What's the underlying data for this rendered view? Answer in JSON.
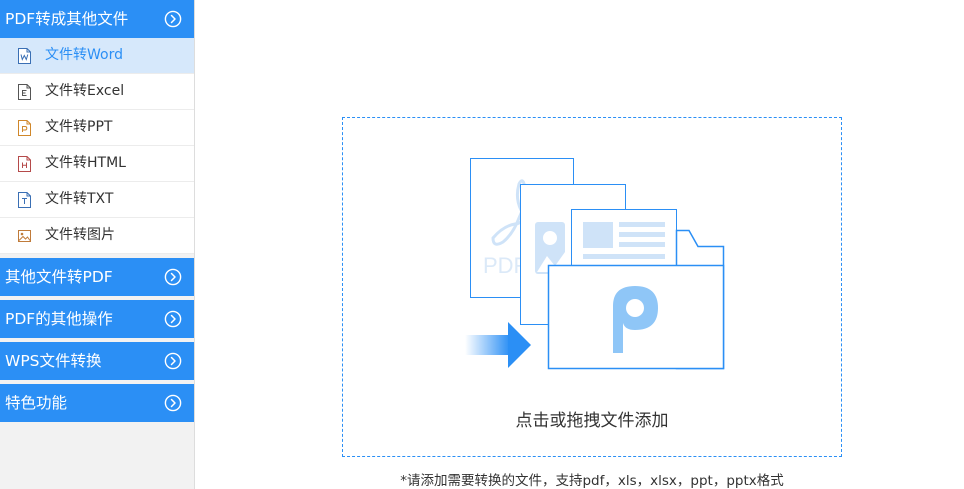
{
  "sidebar": {
    "groups": [
      {
        "label": "PDF转成其他文件",
        "expanded": true,
        "items": [
          {
            "label": "文件转Word",
            "icon": "word-file-icon",
            "active": true
          },
          {
            "label": "文件转Excel",
            "icon": "excel-file-icon",
            "active": false
          },
          {
            "label": "文件转PPT",
            "icon": "ppt-file-icon",
            "active": false
          },
          {
            "label": "文件转HTML",
            "icon": "html-file-icon",
            "active": false
          },
          {
            "label": "文件转TXT",
            "icon": "txt-file-icon",
            "active": false
          },
          {
            "label": "文件转图片",
            "icon": "image-file-icon",
            "active": false
          }
        ]
      },
      {
        "label": "其他文件转PDF",
        "expanded": false
      },
      {
        "label": "PDF的其他操作",
        "expanded": false
      },
      {
        "label": "WPS文件转换",
        "expanded": false
      },
      {
        "label": "特色功能",
        "expanded": false
      }
    ]
  },
  "dropzone": {
    "label": "点击或拖拽文件添加",
    "illustration": {
      "watermark_text": "PDF",
      "icons": [
        "pdf-document-icon",
        "image-document-icon",
        "text-document-icon",
        "folder-icon",
        "arrow-right-icon",
        "wps-pdf-logo-icon"
      ]
    }
  },
  "note": "*请添加需要转换的文件，支持pdf，xls，xlsx，ppt，pptx格式",
  "colors": {
    "accent": "#2b8ff5",
    "active_item_bg": "#d6e8fb",
    "sidebar_bg": "#f2f2f2",
    "illustration_light": "#cfe3f8",
    "logo": "#8fc6f7"
  }
}
